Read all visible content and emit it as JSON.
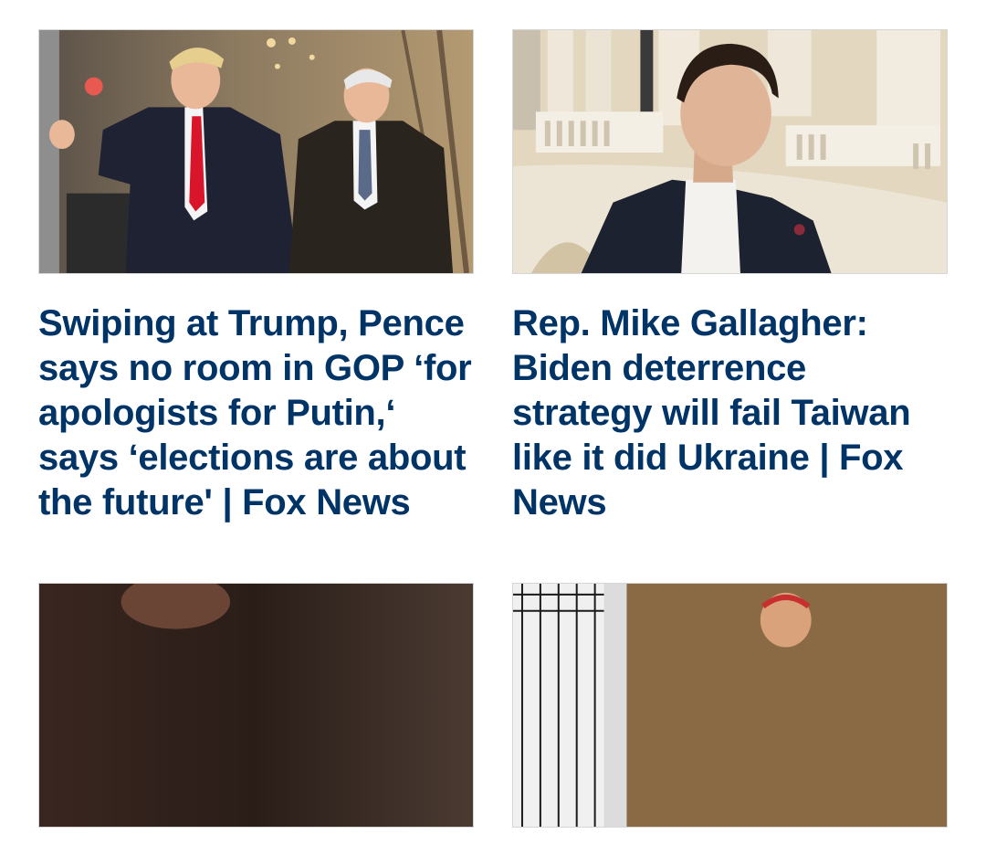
{
  "articles": [
    {
      "headline": "Swiping at Trump, Pence says no room in GOP ‘for apologists for Putin,‘ says ‘elections are about the future' | Fox News",
      "image_icon": "photo-two-men-walking-icon"
    },
    {
      "headline": "Rep. Mike Gallagher: Biden deterrence strategy will fail Taiwan like it did Ukraine | Fox News",
      "image_icon": "photo-man-capitol-rotunda-icon"
    },
    {
      "headline": "",
      "image_icon": "photo-dark-scene-icon"
    },
    {
      "headline": "",
      "image_icon": "photo-soccer-player-icon"
    }
  ],
  "colors": {
    "headline": "#003366",
    "thumb_border": "#d6d6d6"
  }
}
